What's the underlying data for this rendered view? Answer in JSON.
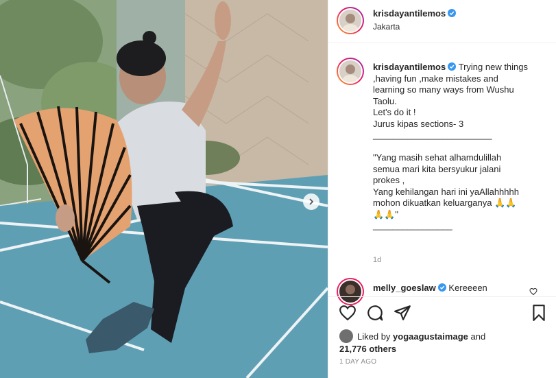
{
  "post": {
    "username": "krisdayantilemos",
    "location": "Jakarta",
    "caption_lines": [
      "Trying new things",
      ",having fun ,make mistakes and",
      "learning so many ways from Wushu",
      "Taolu.",
      "Let's do it !",
      "Jurus kipas sections- 3",
      "________________________",
      "",
      "\"Yang masih sehat alhamdulillah",
      "semua mari kita bersyukur jalani",
      "prokes ,",
      "Yang kehilangan hari ini yaAllahhhhh",
      "mohon dikuatkan keluarganya 🙏🙏",
      "🙏🙏\"",
      "________________"
    ],
    "caption_time": "1d",
    "comment": {
      "username": "melly_goeslaw",
      "text": "Kereeeen"
    },
    "likes": {
      "prefix": "Liked by",
      "user": "yogaagustaimage",
      "and": "and",
      "count": "21,776 others"
    },
    "posted": "1 DAY AGO"
  },
  "icons": {
    "next": "chevron-right-icon",
    "verified": "verified-badge-icon",
    "like": "heart-icon",
    "comment": "comment-bubble-icon",
    "share": "paper-plane-icon",
    "save": "bookmark-icon"
  },
  "colors": {
    "verified": "#3897f0",
    "text": "#262626",
    "muted": "#8e8e8e",
    "court": "#5f9fb4"
  }
}
